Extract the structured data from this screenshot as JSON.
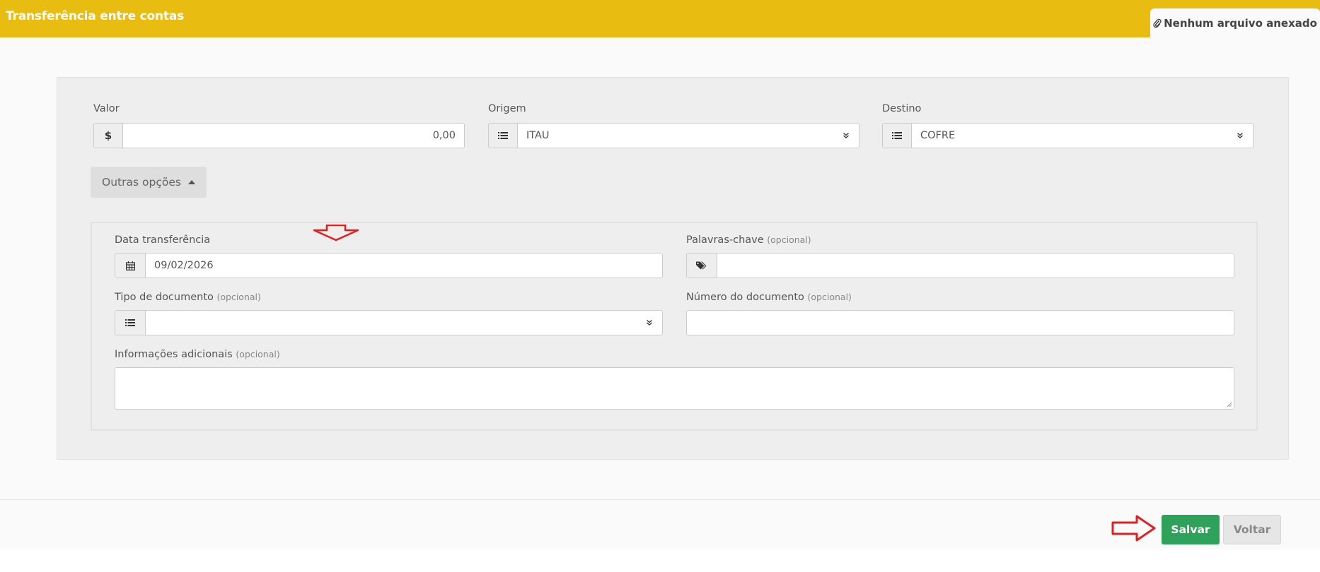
{
  "header": {
    "title": "Transferência entre contas",
    "attachment_label": "Nenhum arquivo anexado"
  },
  "form": {
    "valor": {
      "label": "Valor",
      "addon": "$",
      "value": "0,00"
    },
    "origem": {
      "label": "Origem",
      "value": "ITAU"
    },
    "destino": {
      "label": "Destino",
      "value": "COFRE"
    },
    "outras_opcoes": "Outras opções",
    "data_transferencia": {
      "label": "Data transferência",
      "value": "09/02/2026"
    },
    "palavras_chave": {
      "label": "Palavras-chave",
      "optional": "(opcional)",
      "value": ""
    },
    "tipo_documento": {
      "label": "Tipo de documento",
      "optional": "(opcional)",
      "value": ""
    },
    "numero_documento": {
      "label": "Número do documento",
      "optional": "(opcional)",
      "value": ""
    },
    "informacoes": {
      "label": "Informações adicionais",
      "optional": "(opcional)",
      "value": ""
    }
  },
  "footer": {
    "save_label": "Salvar",
    "back_label": "Voltar"
  },
  "colors": {
    "header_bg": "#e9bc12",
    "save_bg": "#2ea25b",
    "annotation_arrow": "#e02020"
  },
  "icons": {
    "attachment": "paperclip-icon",
    "list": "list-icon",
    "calendar": "calendar-icon",
    "tags": "tags-icon",
    "chevron": "double-chevron-down-icon",
    "caret": "caret-up-icon"
  }
}
